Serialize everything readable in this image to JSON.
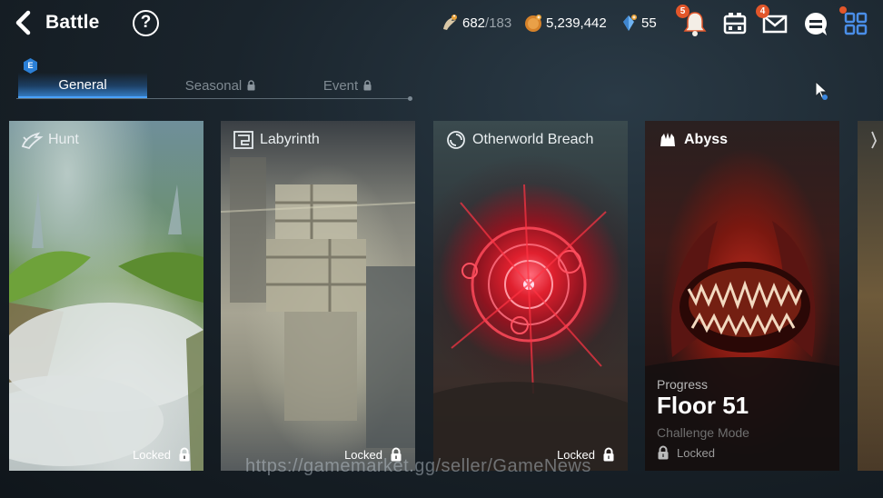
{
  "header": {
    "title": "Battle",
    "help_label": "?"
  },
  "resources": {
    "stamina": {
      "current": "682",
      "max": "/183",
      "icon": "stamina-icon"
    },
    "gold": {
      "value": "5,239,442",
      "icon": "gold-coin-icon"
    },
    "skystone": {
      "value": "55",
      "icon": "skystone-icon"
    }
  },
  "top_icons": {
    "notifications_badge": "5",
    "mail_badge": "4"
  },
  "tabs": {
    "badge": "E",
    "items": [
      {
        "label": "General",
        "active": true
      },
      {
        "label": "Seasonal",
        "locked": true
      },
      {
        "label": "Event",
        "locked": true
      }
    ]
  },
  "cards": {
    "hunt": {
      "title": "Hunt",
      "status": "Locked"
    },
    "labyrinth": {
      "title": "Labyrinth",
      "status": "Locked"
    },
    "breach": {
      "title": "Otherworld Breach",
      "status": "Locked"
    },
    "abyss": {
      "title": "Abyss",
      "progress_label": "Progress",
      "floor": "Floor 51",
      "mode": "Challenge Mode",
      "status": "Locked"
    }
  },
  "watermark": "https://gamemarket.gg/seller/GameNews",
  "colors": {
    "accent": "#4aa2ff",
    "badge": "#e2562a",
    "breach_red": "#e0202e"
  }
}
